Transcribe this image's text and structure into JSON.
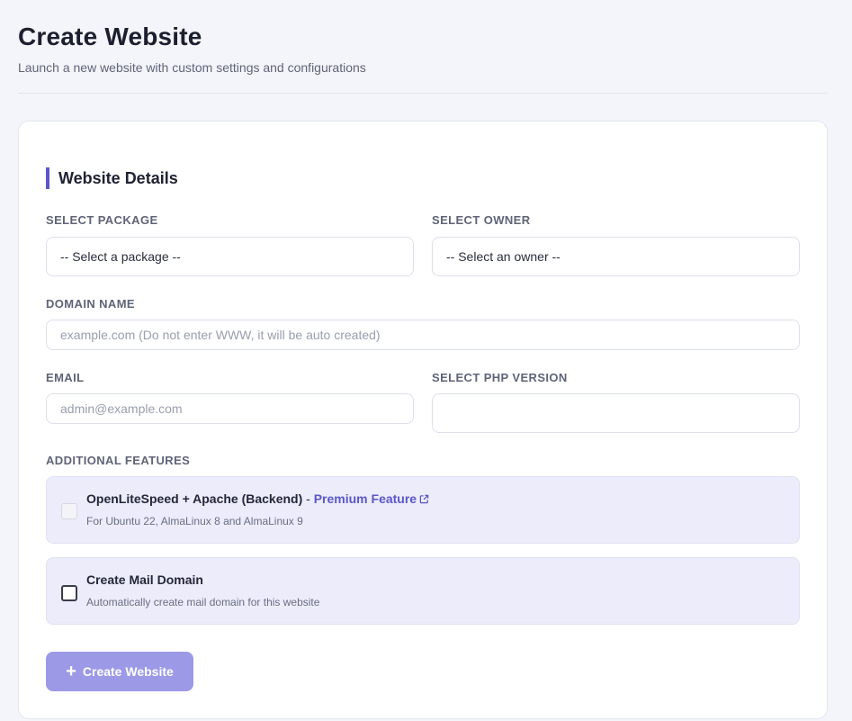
{
  "header": {
    "title": "Create Website",
    "subtitle": "Launch a new website with custom settings and configurations"
  },
  "form": {
    "section_title": "Website Details",
    "package": {
      "label": "SELECT PACKAGE",
      "selected": "-- Select a package --"
    },
    "owner": {
      "label": "SELECT OWNER",
      "selected": "-- Select an owner --"
    },
    "domain": {
      "label": "DOMAIN NAME",
      "value": "",
      "placeholder": "example.com (Do not enter WWW, it will be auto created)"
    },
    "email": {
      "label": "EMAIL",
      "value": "",
      "placeholder": "admin@example.com"
    },
    "php": {
      "label": "SELECT PHP VERSION",
      "selected": ""
    },
    "features_label": "ADDITIONAL FEATURES",
    "features": [
      {
        "title": "OpenLiteSpeed + Apache (Backend)",
        "separator": " - ",
        "link_text": "Premium Feature",
        "link_icon": "external-link-icon",
        "description": "For Ubuntu 22, AlmaLinux 8 and AlmaLinux 9",
        "checked": false,
        "disabled": true
      },
      {
        "title": "Create Mail Domain",
        "description": "Automatically create mail domain for this website",
        "checked": false,
        "disabled": false
      }
    ],
    "submit": {
      "label": "Create Website",
      "icon": "plus-icon"
    }
  },
  "colors": {
    "accent": "#5b57c9",
    "button_bg": "#9c99e6",
    "feature_bg": "#ececfa",
    "page_bg": "#f4f5fa"
  }
}
